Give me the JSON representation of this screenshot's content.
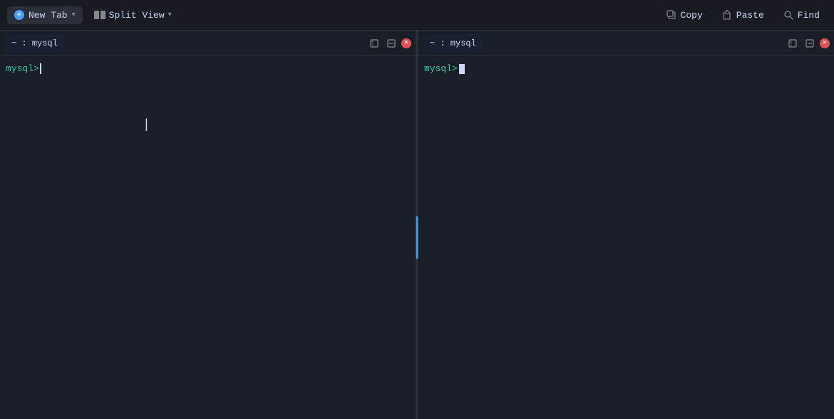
{
  "toolbar": {
    "new_tab_label": "New Tab",
    "split_view_label": "Split View",
    "copy_label": "Copy",
    "paste_label": "Paste",
    "find_label": "Find"
  },
  "pane_left": {
    "tab_title": "~ : mysql",
    "prompt": "mysql> ",
    "cursor": ""
  },
  "pane_right": {
    "tab_title": "~ : mysql",
    "prompt": "mysql> ",
    "cursor": ""
  },
  "colors": {
    "accent": "#4a9eff",
    "prompt": "#2ec9a7",
    "bg_dark": "#1a1e26",
    "bg_toolbar": "#181c22",
    "divider_handle": "#4a9eff"
  }
}
